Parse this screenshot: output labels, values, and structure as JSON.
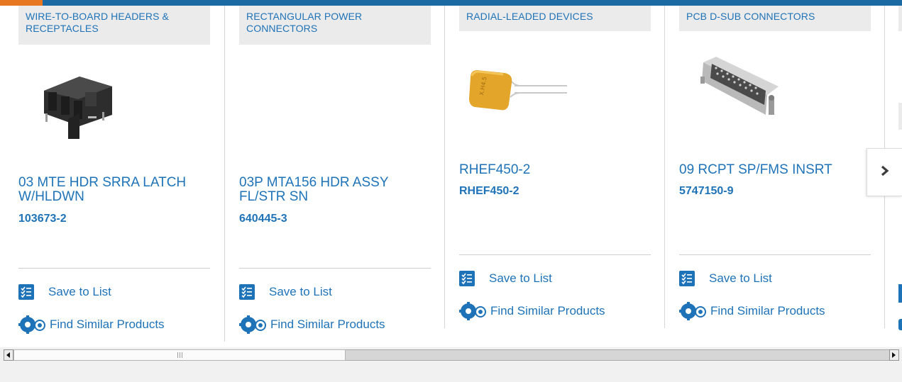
{
  "colors": {
    "link": "#1e73b8",
    "top_bar": "#1b6aa3",
    "accent": "#e87722",
    "category_bg": "#ebebeb"
  },
  "cards": [
    {
      "category": "WIRE-TO-BOARD HEADERS & RECEPTACLES",
      "title": "03 MTE HDR SRRA LATCH W/HLDWN",
      "part_number": "103673-2",
      "save_label": "Save to List",
      "similar_label": "Find Similar Products",
      "image": "black-header-connector"
    },
    {
      "category": "RECTANGULAR POWER CONNECTORS",
      "title": "03P MTA156 HDR ASSY FL/STR SN",
      "part_number": "640445-3",
      "save_label": "Save to List",
      "similar_label": "Find Similar Products",
      "image": "none"
    },
    {
      "category": "RADIAL-LEADED DEVICES",
      "title": "RHEF450-2",
      "part_number": "RHEF450-2",
      "save_label": "Save to List",
      "similar_label": "Find Similar Products",
      "image": "yellow-radial-device"
    },
    {
      "category": "PCB D-SUB CONNECTORS",
      "title": "09 RCPT SP/FMS INSRT",
      "part_number": "5747150-9",
      "save_label": "Save to List",
      "similar_label": "Find Similar Products",
      "image": "d-sub-connector"
    }
  ],
  "carousel": {
    "next_icon": "chevron-right-icon"
  },
  "scrollbar": {
    "left_icon": "scroll-left-icon",
    "right_icon": "scroll-right-icon"
  }
}
